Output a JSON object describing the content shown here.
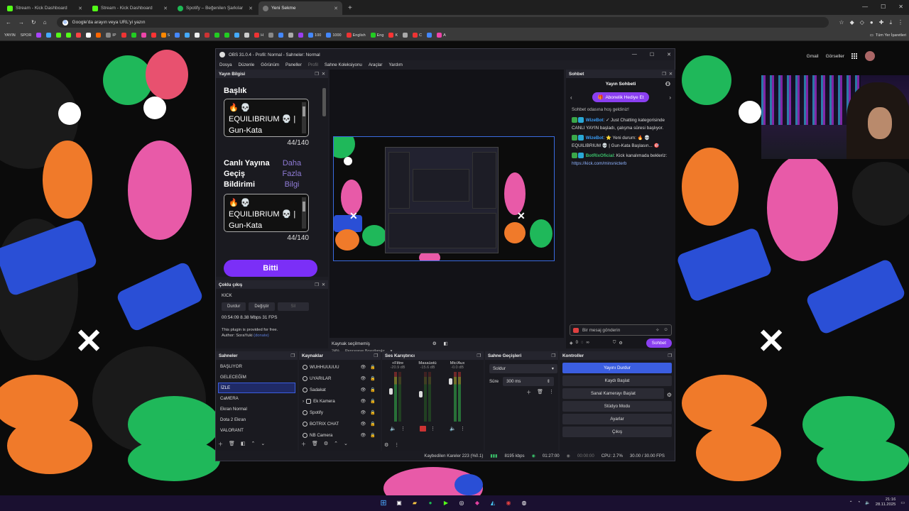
{
  "browser": {
    "tabs": [
      {
        "title": "Stream - Kick Dashboard",
        "active": false,
        "icon": "kick-icon"
      },
      {
        "title": "Stream - Kick Dashboard",
        "active": false,
        "icon": "kick-icon"
      },
      {
        "title": "Spotify – Beğenilen Şarkılar",
        "active": false,
        "icon": "spotify-icon"
      },
      {
        "title": "Yeni Sekme",
        "active": true,
        "icon": "newtab-icon"
      }
    ],
    "address_placeholder": "Google'da arayın veya URL'yi yazın",
    "bookmarks_left": [
      "YAYIN",
      "SPOR"
    ],
    "bookmarks_mid": [
      "IP",
      "S",
      "H",
      "100",
      "1000",
      "English",
      "Eng",
      "K",
      "C",
      "A"
    ],
    "bookmarks_right": "Tüm Yer İşaretleri"
  },
  "google": {
    "gmail": "Gmail",
    "images": "Görseller"
  },
  "obs": {
    "title": "OBS 31.0.4 - Profil: Normal - Sahneler: Normal",
    "menu": [
      "Dosya",
      "Düzenle",
      "Görünüm",
      "Paneller",
      "Profil",
      "Sahne Koleksiyonu",
      "Araçlar",
      "Yardım"
    ],
    "info_panel": {
      "dock_title": "Yayın Bilgisi",
      "title_label": "Başlık",
      "title_value": "🔥 💀 EQUILIBRIUM 💀 | Gun-Kata Başlasın... 🎯",
      "title_count": "44/140",
      "transition_label": "Canlı Yayına Geçiş Bildirimi",
      "more_label": "Daha Fazla Bilgi",
      "transition_value": "🔥 💀 EQUILIBRIUM 💀 | Gun-Kata",
      "transition_count": "44/140",
      "done_button": "Bitti"
    },
    "multi_panel": {
      "dock_title": "Çoklu çıkış",
      "platform": "KICK",
      "stop": "Durdur",
      "change": "Değiştir",
      "delete": "Sil",
      "stats": "00:54:09  8.38 Mbps  31 FPS",
      "note1": "This plugin is provided for free.",
      "note2": "Author: SoraYuki",
      "donate": "(donate)"
    },
    "preview": {
      "zoom": "24%",
      "fit": "Pencereye Boyutlandır",
      "no_source": "Kaynak seçilmemiş"
    },
    "chat": {
      "dock_title": "Sohbet",
      "header": "Yayın Sohbeti",
      "gift_button": "Abonelik Hediye Et",
      "welcome": "Sohbet odasına hoş geldiniz!",
      "messages": [
        {
          "user": "WizeBot",
          "text": "✓ Just Chatting kategorisinde CANLI YAYIN başladı, çalışma süresi başlıyor."
        },
        {
          "user": "WizeBot",
          "text": "⭐ Yeni durum: 🔥 💀 EQUILIBRIUM 💀 | Gun-Kata Başlasın... 🎯"
        },
        {
          "user": "BotRixOficial",
          "text": "Kick kanalımada bekleriz:",
          "link": "https://kick.com/minsnicterb"
        }
      ],
      "input_placeholder": "Bir mesaj gönderin",
      "viewer_count": "0",
      "send_button": "Sohbet"
    },
    "scenes": {
      "dock_title": "Sahneler",
      "items": [
        "BAŞLIYOR",
        "GELECEĞİM",
        "İZLE",
        "CaMERA",
        "Ekran Normal",
        "Dota 2 Ekran",
        "VALORANT"
      ],
      "selected": 2
    },
    "sources": {
      "dock_title": "Kaynaklar",
      "items": [
        "WUHHUUUUU",
        "UYARILAR",
        "Sadakat",
        "Ek Kamera",
        "Spotify",
        "BOTRIX CHAT",
        "NB Camera"
      ]
    },
    "mixer": {
      "dock_title": "Ses Karıştırıcı",
      "channels": [
        {
          "name": "+Filtre",
          "db": "-20.9 dB",
          "level": 0.62
        },
        {
          "name": "Masaüstü",
          "db": "-15.6 dB",
          "level": 0.55
        },
        {
          "name": "Mic/Aux",
          "db": "-0.0 dB",
          "level": 0.85
        }
      ],
      "scale": [
        "0",
        "-5",
        "-10",
        "-15",
        "-20",
        "-25",
        "-30",
        "-35",
        "-40",
        "-45",
        "-50",
        "-55",
        "-60"
      ]
    },
    "transitions": {
      "dock_title": "Sahne Geçişleri",
      "type": "Soldur",
      "duration_label": "Süre",
      "duration": "300 ms"
    },
    "controls": {
      "dock_title": "Kontroller",
      "stop_stream": "Yayını Durdur",
      "start_record": "Kaydı Başlat",
      "virtual_cam": "Sanal Kamerayı Başlat",
      "studio_mode": "Stüdyo Modu",
      "settings": "Ayarlar",
      "exit": "Çıkış"
    },
    "status": {
      "dropped": "Kaybedilen Kareler 223 (%0.1)",
      "bitrate": "8195 kbps",
      "live_time": "01:27:00",
      "rec_time": "00:00:00",
      "cpu": "CPU: 2.7%",
      "fps": "30.00 / 30.00 FPS"
    }
  },
  "taskbar": {
    "time": "21:16",
    "date": "28.11.2025"
  },
  "colors": {
    "obs_accent": "#3b5ee0",
    "kick_purple": "#7b2ff7",
    "kick_green": "#53fc18"
  }
}
